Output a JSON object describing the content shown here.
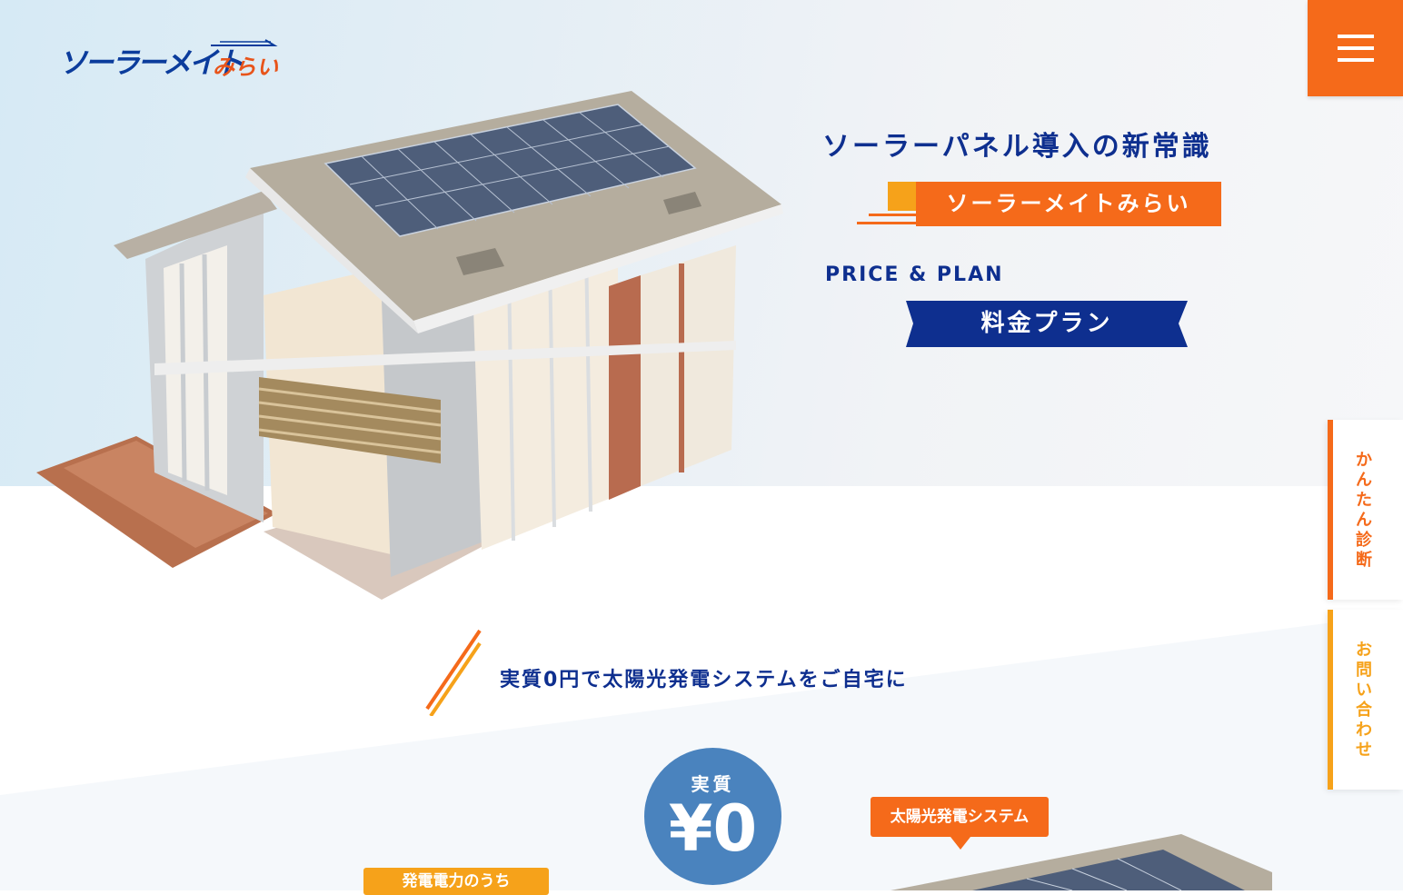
{
  "header": {
    "logo_main": "ソーラーメイト",
    "logo_sub": "みらい"
  },
  "menu": {
    "icon": "hamburger-icon"
  },
  "hero": {
    "headline": "ソーラーパネル導入の新常識",
    "brand": "ソーラーメイトみらい",
    "price_en": "PRICE & PLAN",
    "plan_label": "料金プラン"
  },
  "side_tabs": {
    "diagnosis": "かんたん診断",
    "contact": "お問い合わせ"
  },
  "section": {
    "subhead": "実質0円で太陽光発電システムをご自宅に",
    "badge_top": "実質",
    "badge_value": "¥0",
    "tag_solar": "太陽光発電システム",
    "tag_gen": "発電電力のうち"
  },
  "colors": {
    "navy": "#0e2f8f",
    "orange": "#f56a1a",
    "amber": "#f6a21a",
    "badge_blue": "#4a83be"
  }
}
